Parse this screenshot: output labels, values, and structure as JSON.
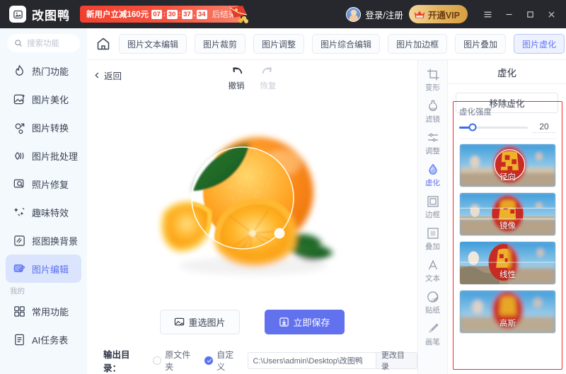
{
  "titlebar": {
    "brand": "改图鸭",
    "logo_icon": "picture-logo-icon",
    "promo": {
      "text": "新用户立减160元",
      "hours": "07",
      "minutes": "30",
      "seconds": "37",
      "centis": "34",
      "sep_colon": ":",
      "sep_dot": ".",
      "suffix": "后结束",
      "envelope_icon": "red-envelope-icon",
      "bg_color": "#f2402f"
    },
    "account_label": "登录/注册",
    "avatar_icon": "user-avatar-icon",
    "vip_label": "开通VIP",
    "vip_icon": "crown-icon",
    "vip_color": "#e3b45f",
    "menu_icon": "hamburger-menu-icon",
    "minimize_icon": "minimize-icon",
    "maximize_icon": "maximize-icon",
    "close_icon": "close-icon"
  },
  "sidebar": {
    "search_placeholder": "搜索功能",
    "search_icon": "search-icon",
    "items": [
      {
        "label": "热门功能",
        "icon": "flame-icon",
        "active": false
      },
      {
        "label": "图片美化",
        "icon": "image-sparkle-icon",
        "active": false
      },
      {
        "label": "图片转换",
        "icon": "convert-icon",
        "active": false
      },
      {
        "label": "图片批处理",
        "icon": "batch-icon",
        "active": false
      },
      {
        "label": "照片修复",
        "icon": "photo-repair-icon",
        "active": false
      },
      {
        "label": "趣味特效",
        "icon": "sparkle-effects-icon",
        "active": false
      },
      {
        "label": "抠图换背景",
        "icon": "cutout-icon",
        "active": false
      },
      {
        "label": "图片编辑",
        "icon": "edit-image-icon",
        "active": true
      }
    ],
    "section_label": "我的",
    "my_items": [
      {
        "label": "常用功能",
        "icon": "grid-icon"
      },
      {
        "label": "AI任务表",
        "icon": "document-icon"
      }
    ],
    "active_color": "#5b72ef"
  },
  "tabbar": {
    "home_icon": "home-icon",
    "tabs": [
      {
        "label": "图片文本编辑",
        "active": false
      },
      {
        "label": "图片裁剪",
        "active": false
      },
      {
        "label": "图片调整",
        "active": false
      },
      {
        "label": "图片综合编辑",
        "active": false
      },
      {
        "label": "图片加边框",
        "active": false
      },
      {
        "label": "图片叠加",
        "active": false
      },
      {
        "label": "图片虚化",
        "active": true
      }
    ]
  },
  "editor": {
    "back_label": "返回",
    "back_icon": "chevron-left-icon",
    "undo_label": "撤销",
    "undo_icon": "undo-arrow-icon",
    "redo_label": "恢复",
    "redo_icon": "redo-arrow-icon",
    "redo_disabled": true,
    "canvas_image": "orange-fruit-with-slices-and-leaves",
    "radial_overlay_icon": "radial-blur-circle-handle",
    "reselect_label": "重选图片",
    "reselect_icon": "image-swap-icon",
    "save_label": "立即保存",
    "save_icon": "download-icon",
    "save_color": "#6271ee"
  },
  "bottombar": {
    "label": "输出目录：",
    "option_original": "原文件夹",
    "option_custom": "自定义",
    "selected_option": "自定义",
    "path_value": "C:\\Users\\admin\\Desktop\\改图鸭",
    "change_label": "更改目录"
  },
  "toolstrip": {
    "tools": [
      {
        "label": "变形",
        "icon": "transform-icon",
        "active": false
      },
      {
        "label": "滤镜",
        "icon": "filter-icon",
        "active": false
      },
      {
        "label": "调整",
        "icon": "adjust-sliders-icon",
        "active": false
      },
      {
        "label": "虚化",
        "icon": "blur-droplet-icon",
        "active": true
      },
      {
        "label": "边框",
        "icon": "frame-icon",
        "active": false
      },
      {
        "label": "叠加",
        "icon": "overlay-icon",
        "active": false
      },
      {
        "label": "文本",
        "icon": "text-icon",
        "active": false
      },
      {
        "label": "贴纸",
        "icon": "sticker-icon",
        "active": false
      },
      {
        "label": "画笔",
        "icon": "brush-icon",
        "active": false
      }
    ],
    "active_color": "#5b72ef"
  },
  "rightpanel": {
    "title": "虚化",
    "remove_label": "移除虚化",
    "slider_label": "虚化强度",
    "slider_value": "20",
    "slider_percent": 20,
    "slider_color": "#3c6bf0",
    "highlight_border_color": "#ee2b2b",
    "presets": [
      {
        "label": "径向",
        "type": "radial",
        "selected": true
      },
      {
        "label": "镜像",
        "type": "mirror",
        "selected": false
      },
      {
        "label": "线性",
        "type": "linear",
        "selected": false
      },
      {
        "label": "高斯",
        "type": "gaussian",
        "selected": false
      }
    ]
  }
}
